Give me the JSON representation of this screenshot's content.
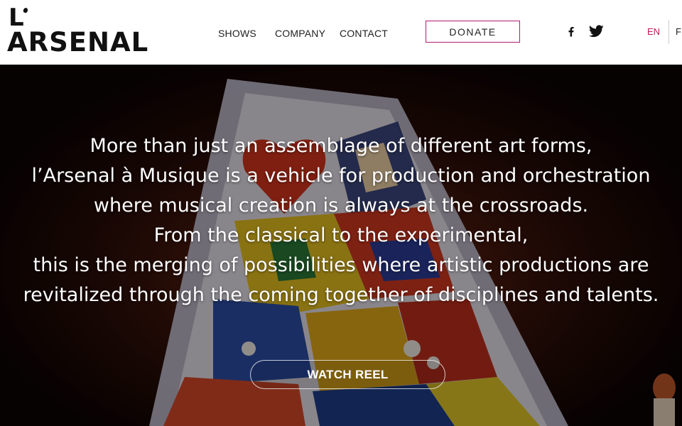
{
  "logo": {
    "top": "L",
    "word": "ARSENAL",
    "alt": "L'Arsenal logo"
  },
  "nav": {
    "items": [
      {
        "label": "SHOWS"
      },
      {
        "label": "COMPANY"
      },
      {
        "label": "CONTACT"
      }
    ],
    "donate_label": "DONATE"
  },
  "social": {
    "icons": [
      "facebook-icon",
      "twitter-icon"
    ]
  },
  "language": {
    "current": "EN",
    "other": "FR"
  },
  "hero": {
    "lines": [
      "More than just an assemblage of different art forms,",
      "l’Arsenal à Musique is a vehicle for production and orchestration",
      "where musical creation is always at the crossroads.",
      "From the classical to the experimental,",
      "this is the merging of possibilities where artistic productions are",
      "revitalized through the coming together of disciplines and talents."
    ],
    "cta_label": "WATCH REEL"
  },
  "colors": {
    "accent": "#c2185b",
    "donate_border": "#b3196e",
    "header_bg": "#ffffff",
    "hero_text": "#ffffff"
  }
}
